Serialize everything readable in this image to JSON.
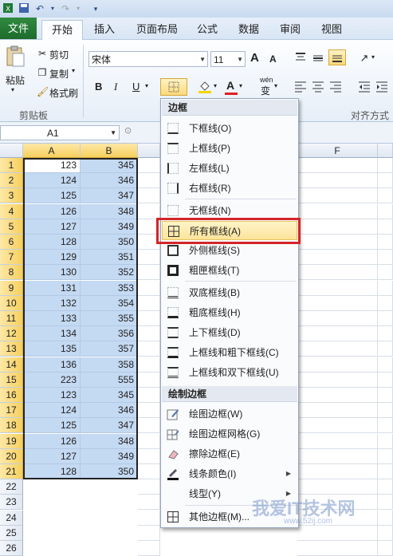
{
  "ribbon": {
    "tabs": [
      "文件",
      "开始",
      "插入",
      "页面布局",
      "公式",
      "数据",
      "审阅",
      "视图"
    ],
    "clipboard": {
      "paste": "粘贴",
      "cut": "剪切",
      "copy": "复制",
      "format_painter": "格式刷",
      "group": "剪贴板"
    },
    "font": {
      "name": "宋体",
      "size": "11",
      "bold": "B",
      "italic": "I",
      "underline": "U",
      "grow": "A",
      "shrink": "A",
      "font_color": "A",
      "wen": "wén",
      "wen_char": "变"
    },
    "alignment_group": "对齐方式"
  },
  "formula_bar": {
    "name_box": "A1"
  },
  "grid": {
    "columns": [
      "A",
      "B",
      "F"
    ],
    "rows": [
      "1",
      "2",
      "3",
      "4",
      "5",
      "6",
      "7",
      "8",
      "9",
      "10",
      "11",
      "12",
      "13",
      "14",
      "15",
      "16",
      "17",
      "18",
      "19",
      "20",
      "21",
      "22",
      "23",
      "24",
      "25",
      "26"
    ],
    "col_a": [
      "123",
      "124",
      "125",
      "126",
      "127",
      "128",
      "129",
      "130",
      "131",
      "132",
      "133",
      "134",
      "135",
      "136",
      "223",
      "123",
      "124",
      "125",
      "126",
      "127",
      "128"
    ],
    "col_b": [
      "345",
      "346",
      "347",
      "348",
      "349",
      "350",
      "351",
      "352",
      "353",
      "354",
      "355",
      "356",
      "357",
      "358",
      "555",
      "345",
      "346",
      "347",
      "348",
      "349",
      "350"
    ]
  },
  "menu": {
    "header1": "边框",
    "items1": [
      "下框线(O)",
      "上框线(P)",
      "左框线(L)",
      "右框线(R)",
      "无框线(N)",
      "所有框线(A)",
      "外侧框线(S)",
      "粗匣框线(T)",
      "双底框线(B)",
      "粗底框线(H)",
      "上下框线(D)",
      "上框线和粗下框线(C)",
      "上框线和双下框线(U)"
    ],
    "header2": "绘制边框",
    "items2": [
      "绘图边框(W)",
      "绘图边框网格(G)",
      "擦除边框(E)",
      "线条颜色(I)",
      "线型(Y)",
      "其他边框(M)..."
    ]
  },
  "watermark": {
    "text": "我爱IT技术网",
    "url": "www.52ij.com"
  },
  "colors": {
    "accent_green": "#1e6b2c",
    "highlight": "#fde49b",
    "selection": "#c4d9f2",
    "callout_red": "#d3262a"
  }
}
